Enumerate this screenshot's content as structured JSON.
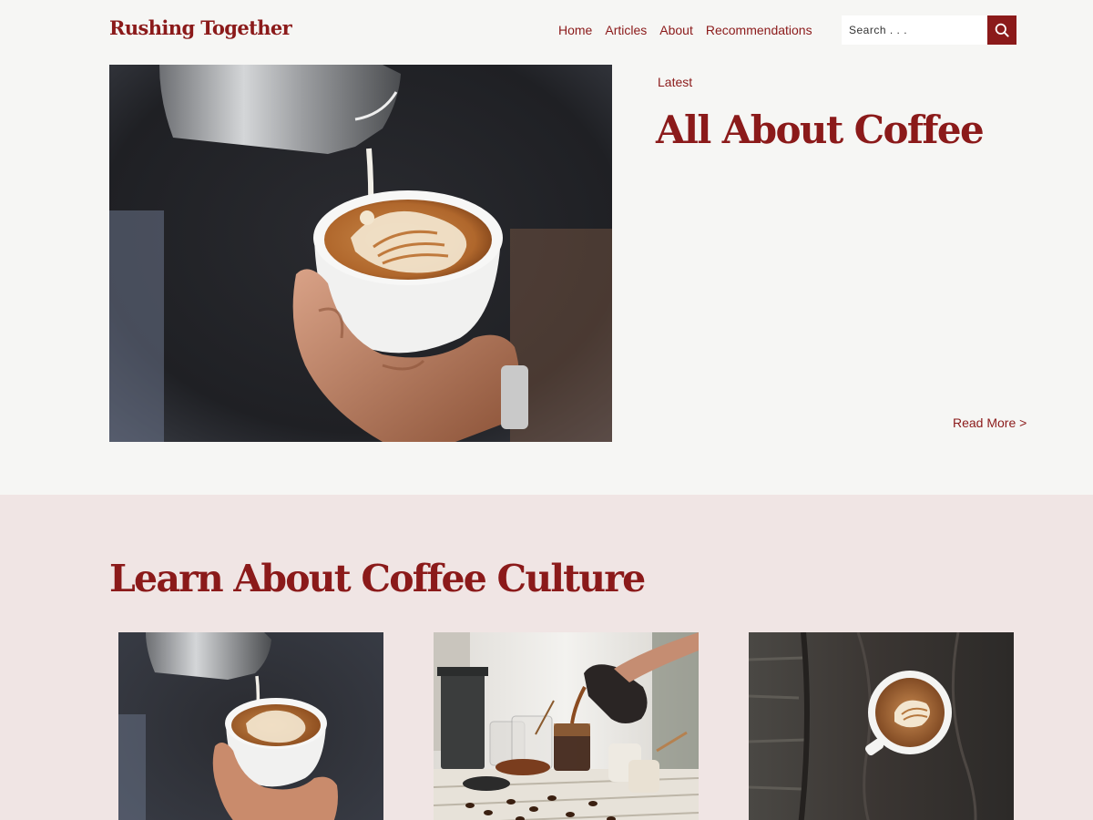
{
  "site": {
    "title": "Rushing Together"
  },
  "nav": {
    "items": [
      {
        "label": "Home"
      },
      {
        "label": "Articles"
      },
      {
        "label": "About"
      },
      {
        "label": "Recommendations"
      }
    ]
  },
  "search": {
    "placeholder": "Search . . .",
    "value": ""
  },
  "featured": {
    "tag": "Latest",
    "title": "All About Coffee",
    "read_more": "Read More >"
  },
  "culture": {
    "title": "Learn About Coffee Culture"
  },
  "colors": {
    "brand": "#8b1a1a",
    "page_background": "#f6f6f4",
    "section_background": "#f0e5e4"
  }
}
